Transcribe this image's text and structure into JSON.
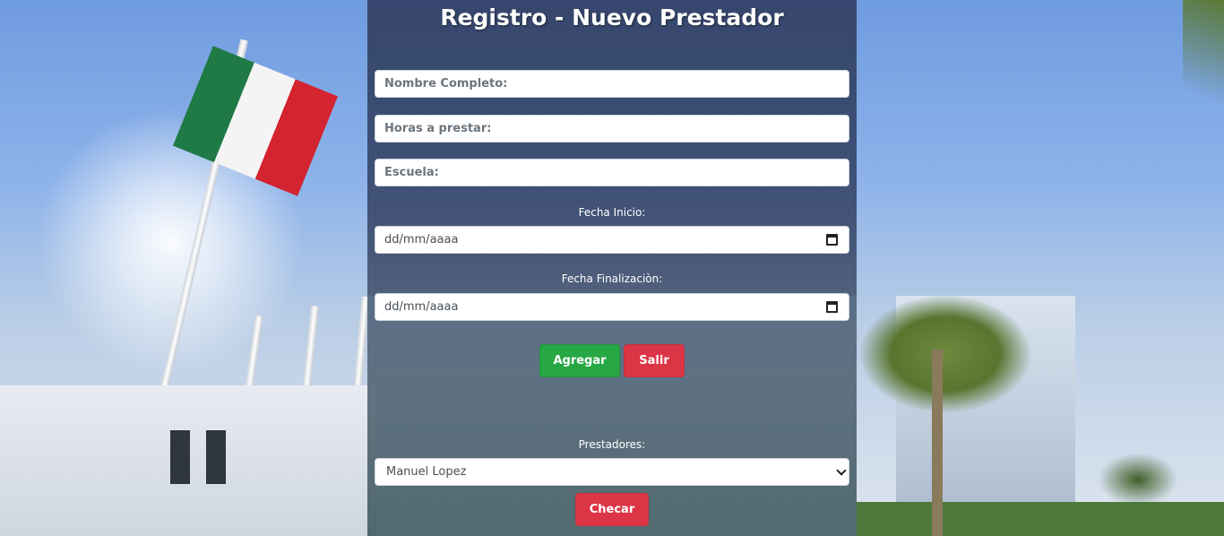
{
  "page": {
    "title": "Registro - Nuevo Prestador"
  },
  "form": {
    "nombre_placeholder": "Nombre Completo:",
    "horas_placeholder": "Horas a prestar:",
    "escuela_placeholder": "Escuela:",
    "fecha_inicio_label": "Fecha Inicio:",
    "fecha_inicio_value": "dd/mm/aaaa",
    "fecha_fin_label": "Fecha Finalizaciòn:",
    "fecha_fin_value": "dd/mm/aaaa",
    "agregar_label": "Agregar",
    "salir_label": "Salir"
  },
  "prestadores": {
    "label": "Prestadores:",
    "selected": "Manuel Lopez",
    "checar_label": "Checar"
  },
  "colors": {
    "primary_button": "#28a745",
    "danger_button": "#dc3545",
    "panel": "#344369"
  },
  "icons": {
    "date": "calendar-icon",
    "select": "chevron-down-icon"
  }
}
